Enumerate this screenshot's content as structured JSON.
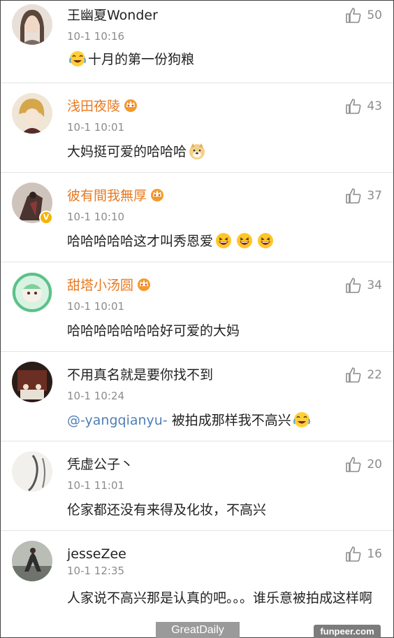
{
  "comments": [
    {
      "name": "王幽夏Wonder",
      "vip": false,
      "time": "10-1 10:16",
      "likes": "50",
      "text_before": "",
      "text": "十月的第一份狗粮",
      "emojis_before": [
        "face-with-tears-of-joy-icon"
      ],
      "emojis_after": [],
      "avatar_color": "#cbb9a8"
    },
    {
      "name": "浅田夜陵",
      "vip": true,
      "time": "10-1 10:01",
      "likes": "43",
      "text": "大妈挺可爱的哈哈哈",
      "emojis_after": [
        "doge-icon"
      ],
      "avatar_color": "#d9c9a3"
    },
    {
      "name": "彼有間我無厚",
      "vip": true,
      "verified": true,
      "time": "10-1 10:10",
      "likes": "37",
      "text": "哈哈哈哈哈这才叫秀恩爱",
      "emojis_after": [
        "laughing-face-icon",
        "laughing-face-icon",
        "laughing-face-icon"
      ],
      "avatar_color": "#5a4a46"
    },
    {
      "name": "甜塔小汤圆",
      "vip": true,
      "time": "10-1 10:01",
      "likes": "34",
      "text": "哈哈哈哈哈哈哈好可爱的大妈",
      "emojis_after": [],
      "avatar_color": "#8fd3a6"
    },
    {
      "name": "不用真名就是要你找不到",
      "vip": false,
      "time": "10-1 10:24",
      "likes": "22",
      "mention": "@-yangqianyu-",
      "text": " 被拍成那样我不高兴",
      "emojis_after": [
        "face-with-tears-of-joy-icon"
      ],
      "avatar_color": "#3a2a24"
    },
    {
      "name": "凭虚公子丶",
      "vip": false,
      "time": "10-1 11:01",
      "likes": "20",
      "text": "伦家都还没有来得及化妆，不高兴",
      "emojis_after": [],
      "avatar_color": "#d8d8d4"
    },
    {
      "name": "jesseZee",
      "vip": false,
      "time": "10-1 12:35",
      "likes": "16",
      "text": "人家说不高兴那是认真的吧。。。谁乐意被拍成这样啊",
      "emojis_after": [],
      "avatar_color": "#8a8f88"
    }
  ],
  "watermarks": {
    "left": "GreatDaily",
    "right": "funpeer.com"
  },
  "colors": {
    "vip_name": "#e8791f",
    "meta_gray": "#8c8c8c",
    "mention_blue": "#4f7fb5",
    "divider": "#e4e4e4"
  }
}
